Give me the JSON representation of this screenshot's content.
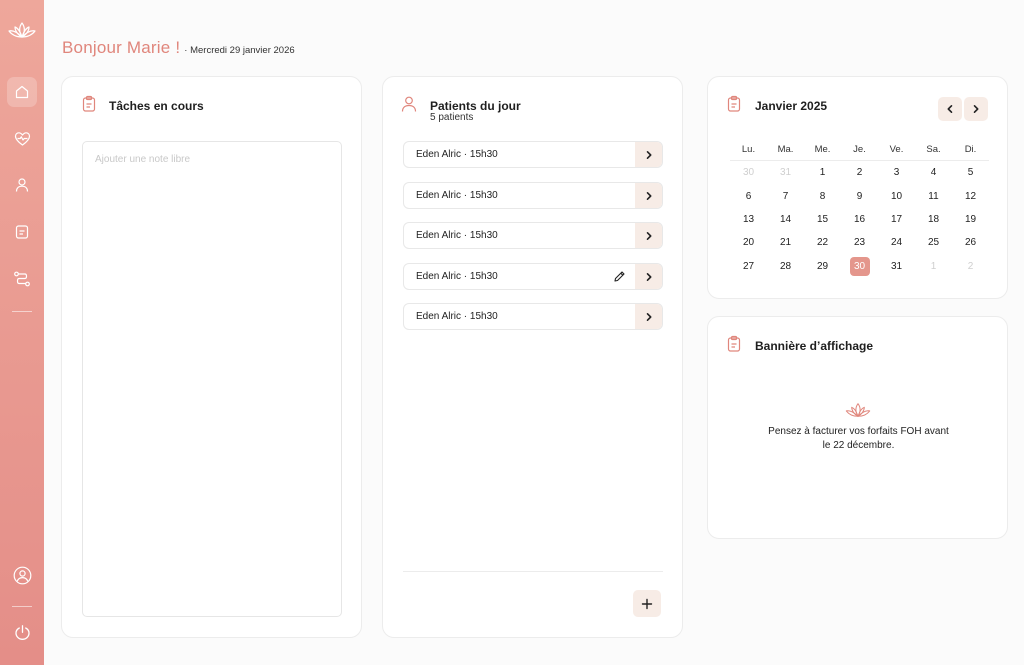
{
  "greeting": {
    "hello": "Bonjour Marie !",
    "date": "· Mercredi 29 janvier 2026"
  },
  "sidebar": {
    "items": [
      {
        "name": "home",
        "icon": "home-icon",
        "active": true
      },
      {
        "name": "health",
        "icon": "heart-pulse-icon",
        "active": false
      },
      {
        "name": "patients",
        "icon": "user-icon",
        "active": false
      },
      {
        "name": "notes",
        "icon": "document-icon",
        "active": false
      },
      {
        "name": "routes",
        "icon": "route-icon",
        "active": false
      }
    ],
    "bottom": [
      {
        "name": "profile",
        "icon": "user-circle-icon"
      },
      {
        "name": "logout",
        "icon": "power-icon"
      }
    ]
  },
  "tasks": {
    "title": "Tâches en cours",
    "placeholder": "Ajouter une note libre",
    "value": ""
  },
  "patients": {
    "title": "Patients du jour",
    "subtitle": "5 patients",
    "list": [
      {
        "label": "Eden Alric · 15h30",
        "editable": false
      },
      {
        "label": "Eden Alric · 15h30",
        "editable": false
      },
      {
        "label": "Eden Alric · 15h30",
        "editable": false
      },
      {
        "label": "Eden Alric · 15h30",
        "editable": true
      },
      {
        "label": "Eden Alric · 15h30",
        "editable": false
      }
    ]
  },
  "calendar": {
    "title": "Janvier 2025",
    "weekdays": [
      "Lu.",
      "Ma.",
      "Me.",
      "Je.",
      "Ve.",
      "Sa.",
      "Di."
    ],
    "weeks": [
      [
        {
          "d": "30",
          "muted": true
        },
        {
          "d": "31",
          "muted": true
        },
        {
          "d": "1"
        },
        {
          "d": "2"
        },
        {
          "d": "3"
        },
        {
          "d": "4"
        },
        {
          "d": "5"
        }
      ],
      [
        {
          "d": "6"
        },
        {
          "d": "7"
        },
        {
          "d": "8"
        },
        {
          "d": "9"
        },
        {
          "d": "10"
        },
        {
          "d": "11"
        },
        {
          "d": "12"
        }
      ],
      [
        {
          "d": "13"
        },
        {
          "d": "14"
        },
        {
          "d": "15"
        },
        {
          "d": "16"
        },
        {
          "d": "17"
        },
        {
          "d": "18"
        },
        {
          "d": "19"
        }
      ],
      [
        {
          "d": "20"
        },
        {
          "d": "21"
        },
        {
          "d": "22"
        },
        {
          "d": "23"
        },
        {
          "d": "24"
        },
        {
          "d": "25"
        },
        {
          "d": "26"
        }
      ],
      [
        {
          "d": "27"
        },
        {
          "d": "28"
        },
        {
          "d": "29"
        },
        {
          "d": "30",
          "today": true
        },
        {
          "d": "31"
        },
        {
          "d": "1",
          "muted": true
        },
        {
          "d": "2",
          "muted": true
        }
      ]
    ]
  },
  "banner": {
    "title": "Bannière d’affichage",
    "line1": "Pensez à facturer vos forfaits FOH avant",
    "line2": "le 22 décembre."
  },
  "colors": {
    "accent": "#e0867c",
    "sidebar_top": "#eea79b",
    "sidebar_bottom": "#e48e88",
    "button_bg": "#f7ece6",
    "today_bg": "#e4968c"
  }
}
